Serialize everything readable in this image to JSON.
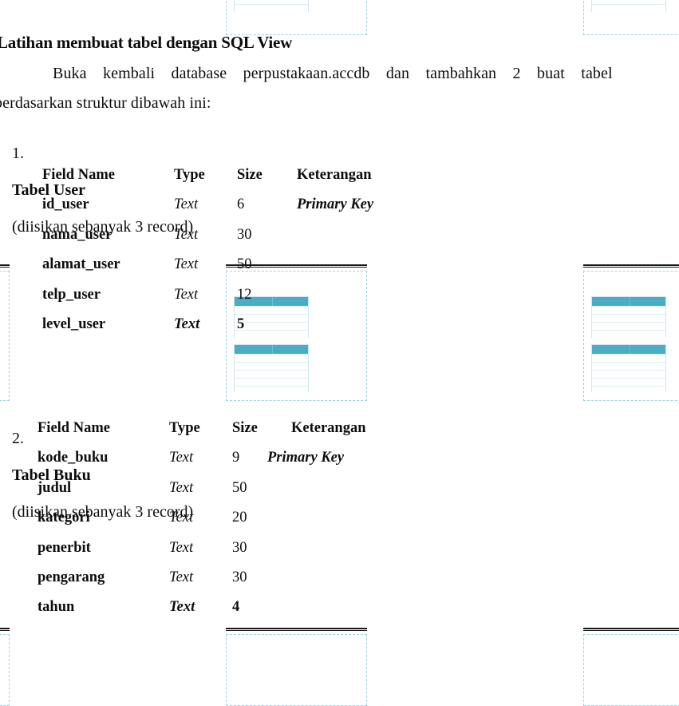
{
  "document": {
    "heading": "Latihan membuat tabel dengan SQL View",
    "paragraph_line1": "Buka    kembali    database    perpustakaan.accdb    dan    tambahkan    2    buat    tabel",
    "paragraph_line2": "berdasarkan struktur dibawah ini:",
    "accent_color": "#4bacc6",
    "text_color": "#0d0d0d",
    "list": [
      {
        "number": "1.",
        "name": "Tabel User",
        "note": "(diisikan sebanyak 3 record)"
      },
      {
        "number": "2.",
        "name": "Tabel Buku",
        "note": "(diisikan sebanyak 3 record)"
      }
    ]
  },
  "table_user": {
    "headers": {
      "field": "Field Name",
      "type": "Type",
      "size": "Size",
      "note": "Keterangan"
    },
    "rows": [
      {
        "field": "id_user",
        "type": "Text",
        "size": "6",
        "note": "Primary Key"
      },
      {
        "field": "nama_user",
        "type": "Text",
        "size": "30",
        "note": ""
      },
      {
        "field": "alamat_user",
        "type": "Text",
        "size": "50",
        "note": ""
      },
      {
        "field": "telp_user",
        "type": "Text",
        "size": "12",
        "note": ""
      },
      {
        "field": "level_user",
        "type": "Text",
        "size": "5",
        "note": ""
      }
    ]
  },
  "table_buku": {
    "headers": {
      "field": "Field Name",
      "type": "Type",
      "size": "Size",
      "note": "Keterangan"
    },
    "rows": [
      {
        "field": "kode_buku",
        "type": "Text",
        "size": "9",
        "note": "Primary Key"
      },
      {
        "field": "judul",
        "type": "Text",
        "size": "50",
        "note": ""
      },
      {
        "field": "kategori",
        "type": "Text",
        "size": "20",
        "note": ""
      },
      {
        "field": "penerbit",
        "type": "Text",
        "size": "30",
        "note": ""
      },
      {
        "field": "pengarang",
        "type": "Text",
        "size": "30",
        "note": ""
      },
      {
        "field": "tahun",
        "type": "Text",
        "size": "4",
        "note": ""
      }
    ]
  }
}
